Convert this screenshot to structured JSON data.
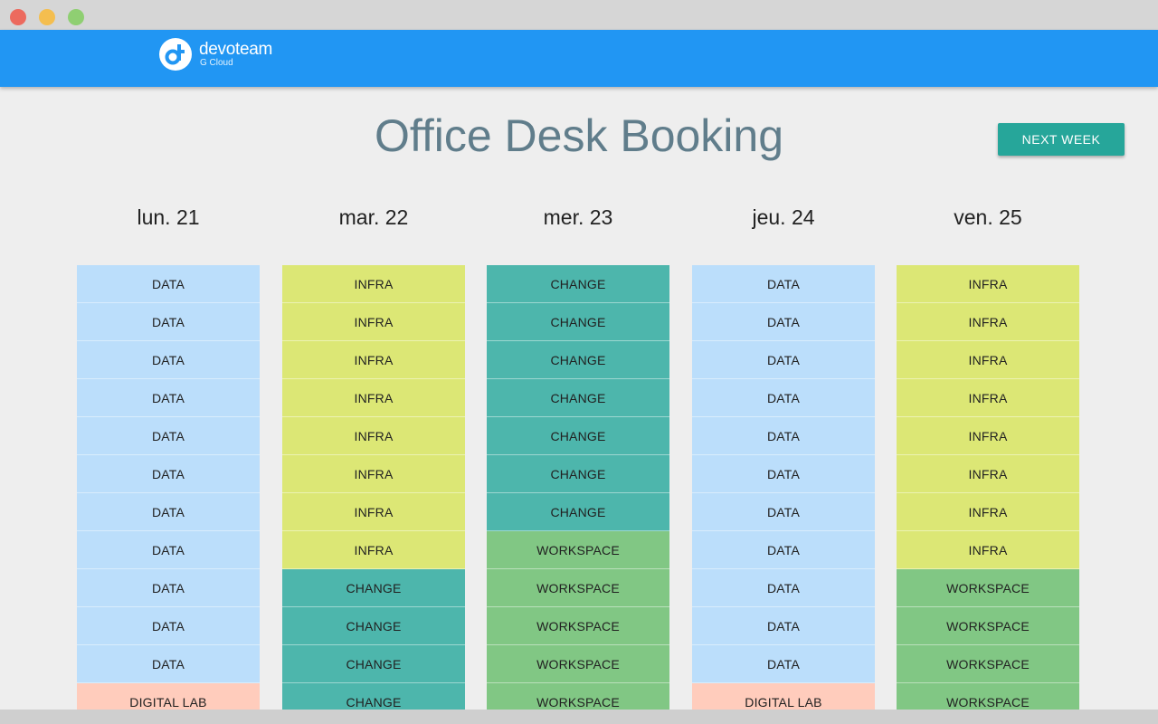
{
  "window": {
    "controls": [
      "close",
      "minimize",
      "zoom"
    ]
  },
  "header": {
    "brand_name": "devoteam",
    "brand_sub": "G Cloud",
    "logo_icon": "devoteam-logo-icon"
  },
  "page": {
    "title": "Office Desk Booking",
    "next_week_label": "NEXT WEEK"
  },
  "team_colors": {
    "DATA": "#bbdefb",
    "INFRA": "#dce775",
    "CHANGE": "#4db6ac",
    "WORKSPACE": "#81c784",
    "DIGITAL LAB": "#ffccbc"
  },
  "days": [
    {
      "label": "lun. 21",
      "slots": [
        "DATA",
        "DATA",
        "DATA",
        "DATA",
        "DATA",
        "DATA",
        "DATA",
        "DATA",
        "DATA",
        "DATA",
        "DATA",
        "DIGITAL LAB"
      ]
    },
    {
      "label": "mar. 22",
      "slots": [
        "INFRA",
        "INFRA",
        "INFRA",
        "INFRA",
        "INFRA",
        "INFRA",
        "INFRA",
        "INFRA",
        "CHANGE",
        "CHANGE",
        "CHANGE",
        "CHANGE"
      ]
    },
    {
      "label": "mer. 23",
      "slots": [
        "CHANGE",
        "CHANGE",
        "CHANGE",
        "CHANGE",
        "CHANGE",
        "CHANGE",
        "CHANGE",
        "WORKSPACE",
        "WORKSPACE",
        "WORKSPACE",
        "WORKSPACE",
        "WORKSPACE"
      ]
    },
    {
      "label": "jeu. 24",
      "slots": [
        "DATA",
        "DATA",
        "DATA",
        "DATA",
        "DATA",
        "DATA",
        "DATA",
        "DATA",
        "DATA",
        "DATA",
        "DATA",
        "DIGITAL LAB"
      ]
    },
    {
      "label": "ven. 25",
      "slots": [
        "INFRA",
        "INFRA",
        "INFRA",
        "INFRA",
        "INFRA",
        "INFRA",
        "INFRA",
        "INFRA",
        "WORKSPACE",
        "WORKSPACE",
        "WORKSPACE",
        "WORKSPACE"
      ]
    }
  ]
}
